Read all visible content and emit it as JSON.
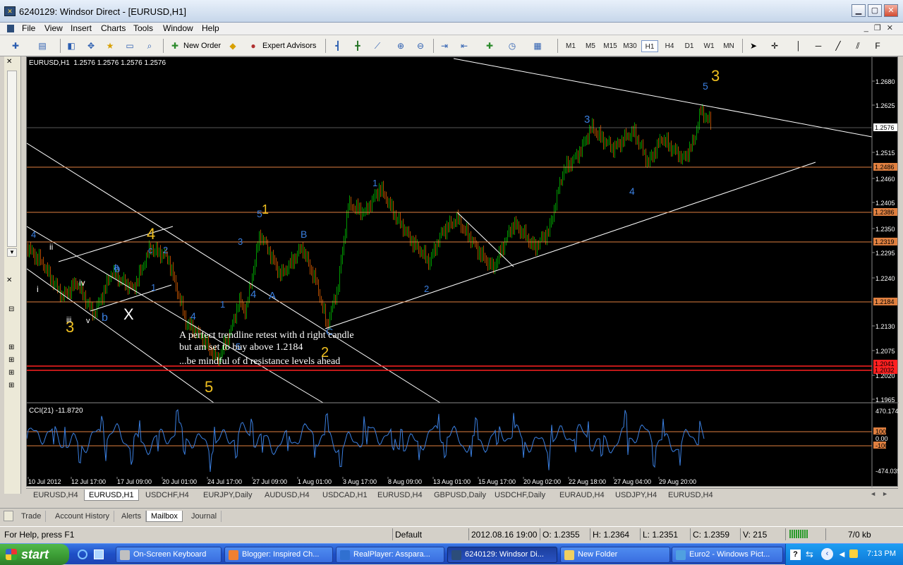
{
  "window": {
    "title": "6240129: Windsor Direct - [EURUSD,H1]"
  },
  "menu": [
    "File",
    "View",
    "Insert",
    "Charts",
    "Tools",
    "Window",
    "Help"
  ],
  "toolbar": {
    "new_order": "New Order",
    "expert_advisors": "Expert Advisors",
    "timeframes": [
      "M1",
      "M5",
      "M15",
      "M30",
      "H1",
      "H4",
      "D1",
      "W1",
      "MN"
    ],
    "active_timeframe": "H1"
  },
  "chart": {
    "header": "EURUSD,H1  1.2576 1.2576 1.2576 1.2576",
    "indicator_header": "CCI(21) -11.8720",
    "price_labels": [
      "1.2680",
      "1.2625",
      "1.2515",
      "1.2460",
      "1.2405",
      "1.2350",
      "1.2295",
      "1.2240",
      "1.2130",
      "1.2075",
      "1.2020",
      "1.1965"
    ],
    "highlight_labels": [
      {
        "text": "1.2576",
        "kind": "current"
      },
      {
        "text": "1.2486",
        "kind": "level"
      },
      {
        "text": "1.2386",
        "kind": "level"
      },
      {
        "text": "1.2319",
        "kind": "level"
      },
      {
        "text": "1.2184",
        "kind": "level"
      },
      {
        "text": "1.2041",
        "kind": "red"
      },
      {
        "text": "1.2032",
        "kind": "red"
      }
    ],
    "cci_labels": [
      "470.1741",
      "100",
      "0.00",
      "-100",
      "-474.0391"
    ],
    "time_labels": [
      "10 Jul 2012",
      "12 Jul 17:00",
      "17 Jul 09:00",
      "20 Jul 01:00",
      "24 Jul 17:00",
      "27 Jul 09:00",
      "1 Aug 01:00",
      "3 Aug 17:00",
      "8 Aug 09:00",
      "13 Aug 01:00",
      "15 Aug 17:00",
      "20 Aug 02:00",
      "22 Aug 18:00",
      "27 Aug 04:00",
      "29 Aug 20:00"
    ],
    "annotation": [
      "A perfect trendline retest with d right candle",
      "but am set to buy above 1.2184",
      "...be mindful of d resistance levels ahead"
    ],
    "wave_labels": [
      {
        "t": "3",
        "c": "#f0c020",
        "s": 22
      },
      {
        "t": "5",
        "c": "#3a7fe0",
        "s": 14
      },
      {
        "t": "3",
        "c": "#3a7fe0",
        "s": 15
      },
      {
        "t": "4",
        "c": "#3a7fe0",
        "s": 14
      },
      {
        "t": "1",
        "c": "#3a7fe0",
        "s": 13
      },
      {
        "t": "5",
        "c": "#3a7fe0",
        "s": 14
      },
      {
        "t": "1",
        "c": "#f0c020",
        "s": 18
      },
      {
        "t": "3",
        "c": "#3a7fe0",
        "s": 13
      },
      {
        "t": "B",
        "c": "#3a7fe0",
        "s": 14
      },
      {
        "t": "4",
        "c": "#3a7fe0",
        "s": 15
      },
      {
        "t": "A",
        "c": "#3a7fe0",
        "s": 15
      },
      {
        "t": "2",
        "c": "#3a7fe0",
        "s": 13
      },
      {
        "t": "C",
        "c": "#3a7fe0",
        "s": 14
      },
      {
        "t": "2",
        "c": "#f0c020",
        "s": 20
      },
      {
        "t": "1",
        "c": "#3a7fe0",
        "s": 13
      },
      {
        "t": "4",
        "c": "#3a7fe0",
        "s": 14
      },
      {
        "t": "5",
        "c": "#3a7fe0",
        "s": 13
      },
      {
        "t": "5",
        "c": "#f0c020",
        "s": 22
      },
      {
        "t": "4",
        "c": "#f0c020",
        "s": 22
      },
      {
        "t": "2",
        "c": "#3a7fe0",
        "s": 13
      },
      {
        "t": "c",
        "c": "#3a7fe0",
        "s": 13
      },
      {
        "t": "a",
        "c": "#3a7fe0",
        "s": 14
      },
      {
        "t": "b",
        "c": "#3a7fe0",
        "s": 15
      },
      {
        "t": "1",
        "c": "#3a7fe0",
        "s": 13
      },
      {
        "t": "X",
        "c": "#ffffff",
        "s": 22
      },
      {
        "t": "b",
        "c": "#3a7fe0",
        "s": 16
      },
      {
        "t": "3",
        "c": "#f0c020",
        "s": 22
      },
      {
        "t": "4",
        "c": "#3a7fe0",
        "s": 13
      },
      {
        "t": "ii",
        "c": "#ffffff",
        "s": 12
      },
      {
        "t": "iv",
        "c": "#ffffff",
        "s": 12
      },
      {
        "t": "i",
        "c": "#ffffff",
        "s": 12
      },
      {
        "t": "iii",
        "c": "#ffffff",
        "s": 11
      },
      {
        "t": "v",
        "c": "#ffffff",
        "s": 11
      }
    ]
  },
  "symbol_tabs": [
    "EURUSD,H4",
    "EURUSD,H1",
    "USDCHF,H4",
    "EURJPY,Daily",
    "AUDUSD,H4",
    "USDCAD,H1",
    "EURUSD,H4",
    "GBPUSD,Daily",
    "USDCHF,Daily",
    "EURAUD,H4",
    "USDJPY,H4",
    "EURUSD,H4"
  ],
  "active_symbol_tab": 1,
  "terminal_tabs": [
    "Trade",
    "Account History",
    "Alerts",
    "Mailbox",
    "Journal"
  ],
  "active_terminal_tab": 3,
  "status": {
    "help": "For Help, press F1",
    "profile": "Default",
    "datetime": "2012.08.16 19:00",
    "open": "O: 1.2355",
    "high": "H: 1.2364",
    "low": "L: 1.2351",
    "close": "C: 1.2359",
    "volume": "V: 215",
    "traffic": "7/0 kb"
  },
  "taskbar": {
    "start": "start",
    "tasks": [
      "On-Screen Keyboard",
      "Blogger: Inspired Ch...",
      "RealPlayer: Asspara...",
      "6240129: Windsor Di...",
      "New Folder",
      "Euro2 - Windows Pict..."
    ],
    "active_task": 3,
    "clock": "7:13 PM"
  },
  "colors": {
    "bull": "#00c000",
    "bear": "#e06000",
    "level": "#e08040",
    "support": "#ff2020",
    "cci": "#3a7fe0",
    "wave_blue": "#3a7fe0",
    "wave_yellow": "#f0c020"
  }
}
